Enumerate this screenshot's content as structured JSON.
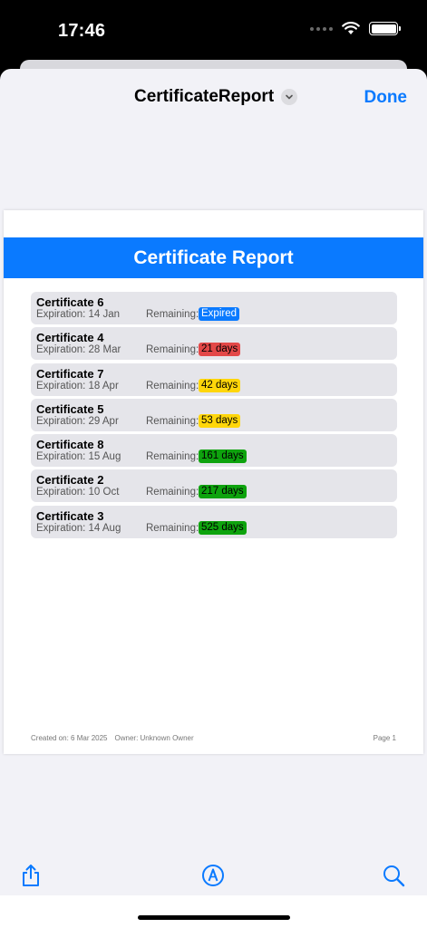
{
  "status": {
    "time": "17:46"
  },
  "nav": {
    "title": "CertificateReport",
    "done_label": "Done"
  },
  "report": {
    "title": "Certificate Report",
    "exp_prefix": "Expiration:",
    "rem_prefix": "Remaining:",
    "certificates": [
      {
        "name": "Certificate 6",
        "expiration": "Expiration: 14 Jan",
        "remaining_label": "Remaining:",
        "remaining": "Expired",
        "status": "blue"
      },
      {
        "name": "Certificate 4",
        "expiration": "Expiration: 28 Mar",
        "remaining_label": "Remaining:",
        "remaining": "21 days",
        "status": "red"
      },
      {
        "name": "Certificate 7",
        "expiration": "Expiration: 18 Apr",
        "remaining_label": "Remaining:",
        "remaining": "42 days",
        "status": "yellow"
      },
      {
        "name": "Certificate 5",
        "expiration": "Expiration: 29 Apr",
        "remaining_label": "Remaining:",
        "remaining": "53 days",
        "status": "yellow"
      },
      {
        "name": "Certificate 8",
        "expiration": "Expiration: 15 Aug",
        "remaining_label": "Remaining:",
        "remaining": "161 days",
        "status": "green"
      },
      {
        "name": "Certificate 2",
        "expiration": "Expiration: 10 Oct",
        "remaining_label": "Remaining:",
        "remaining": "217 days",
        "status": "green"
      },
      {
        "name": "Certificate 3",
        "expiration": "Expiration: 14 Aug",
        "remaining_label": "Remaining:",
        "remaining": "525 days",
        "status": "green"
      }
    ],
    "footer_created": "Created on: 6 Mar 2025",
    "footer_owner": "Owner: Unknown Owner",
    "footer_page": "Page 1"
  },
  "colors": {
    "accent": "#0a7aff",
    "expired": "#0a7aff",
    "urgent": "#e34848",
    "warning": "#ffd60a",
    "ok": "#0ea30e"
  },
  "icons": {
    "share": "share-icon",
    "markup": "markup-icon",
    "search": "search-icon"
  }
}
